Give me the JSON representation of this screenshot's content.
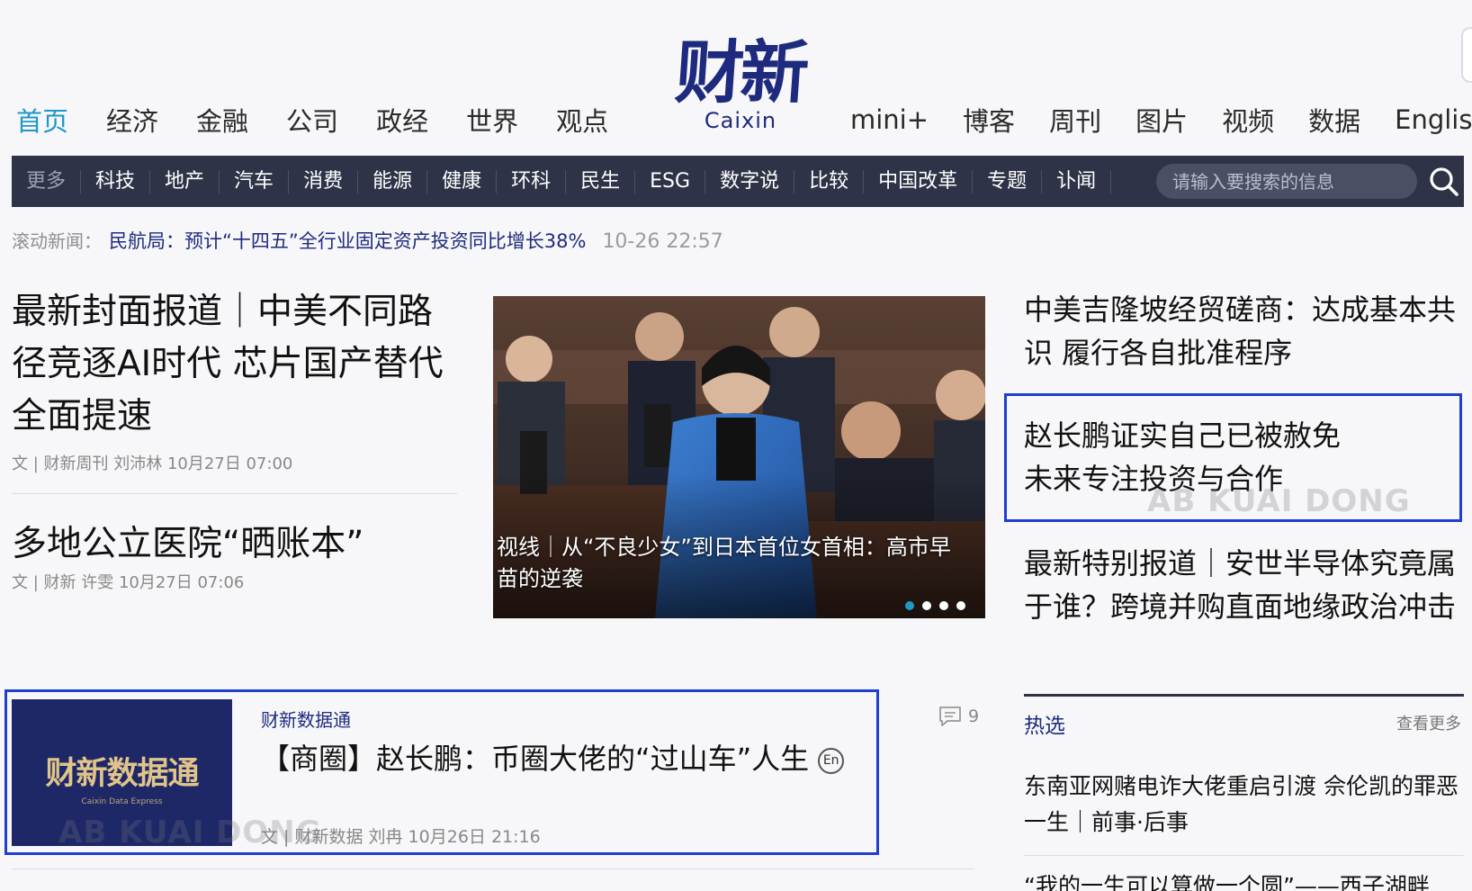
{
  "nav": {
    "left": [
      "首页",
      "经济",
      "金融",
      "公司",
      "政经",
      "世界",
      "观点"
    ],
    "right": [
      "mini+",
      "博客",
      "周刊",
      "图片",
      "视频",
      "数据",
      "English"
    ]
  },
  "logo": {
    "cn": "财新",
    "en": "Caixin"
  },
  "subnav": {
    "more": "更多",
    "items": [
      "科技",
      "地产",
      "汽车",
      "消费",
      "能源",
      "健康",
      "环科",
      "民生",
      "ESG",
      "数字说",
      "比较",
      "中国改革",
      "专题",
      "讣闻"
    ],
    "search_placeholder": "请输入要搜索的信息"
  },
  "ticker": {
    "label": "滚动新闻：",
    "text": "民航局：预计“十四五”全行业固定资产投资同比增长38%",
    "time": "10-26 22:57"
  },
  "lead": {
    "title": "最新封面报道｜中美不同路径竞逐AI时代 芯片国产替代全面提速",
    "byline": "文 | 财新周刊 刘沛林 10月27日 07:00"
  },
  "second": {
    "title": "多地公立医院“晒账本”",
    "byline": "文 | 财新 许雯 10月27日 07:06"
  },
  "hero": {
    "caption": "视线｜从“不良少女”到日本首位女首相：高市早苗的逆袭",
    "slide_count": 4,
    "active_slide": 0
  },
  "right": {
    "items": [
      "中美吉隆坡经贸磋商：达成基本共识 履行各自批准程序",
      "赵长鹏证实自己已被赦免\n未来专注投资与合作",
      "最新特别报道｜安世半导体究竟属于谁？跨境并购直面地缘政治冲击"
    ]
  },
  "watermark": "AB KUAI DONG",
  "hot": {
    "title": "热选",
    "more": "查看更多",
    "items": [
      "东南亚网赌电诈大佬重启引渡 佘伦凯的罪恶一生｜前事·后事",
      "“我的一生可以算做一个圆”——西子湖畔"
    ]
  },
  "card": {
    "thumb_cn": "财新数据通",
    "thumb_en": "Caixin Data Express",
    "tag": "财新数据通",
    "title": "【商圈】赵长鹏：币圈大佬的“过山车”人生",
    "badge": "En",
    "comments": "9",
    "byline": "文 | 财新数据 刘冉 10月26日 21:16"
  },
  "colors": {
    "accent": "#1d98c9",
    "brand": "#1e2a7e",
    "subnav_bg": "#2e3347",
    "highlight": "#1e3fd0"
  }
}
